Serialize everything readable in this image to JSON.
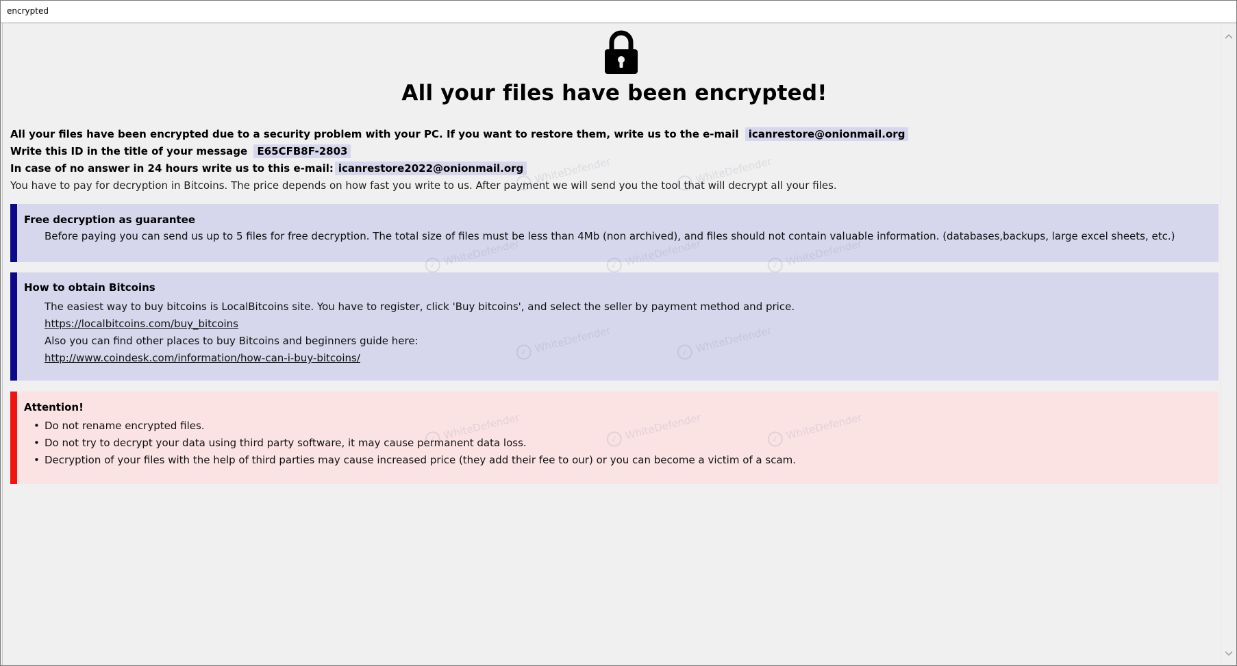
{
  "window": {
    "title": "encrypted"
  },
  "header": {
    "headline": "All your files have been encrypted!"
  },
  "intro": {
    "line1_text": "All your files have been encrypted due to a security problem with your PC. If you want to restore them, write us to the e-mail",
    "line1_email": "icanrestore@onionmail.org",
    "line2_text": "Write this ID in the title of your message",
    "line2_id": "E65CFB8F-2803",
    "line3_text": "In case of no answer in 24 hours write us to this e-mail:",
    "line3_email": "icanrestore2022@onionmail.org",
    "line4_text": "You have to pay for decryption in Bitcoins. The price depends on how fast you write to us. After payment we will send you the tool that will decrypt all your files."
  },
  "panels": {
    "free": {
      "title": "Free decryption as guarantee",
      "text": "Before paying you can send us up to 5 files for free decryption. The total size of files must be less than 4Mb (non archived), and files should not contain valuable information. (databases,backups, large excel sheets, etc.)"
    },
    "bitcoins": {
      "title": "How to obtain Bitcoins",
      "text1": "The easiest way to buy bitcoins is LocalBitcoins site. You have to register, click 'Buy bitcoins', and select the seller by payment method and price.",
      "link1": "https://localbitcoins.com/buy_bitcoins",
      "text2": "Also you can find other places to buy Bitcoins and beginners guide here:",
      "link2": "http://www.coindesk.com/information/how-can-i-buy-bitcoins/"
    },
    "attention": {
      "title": "Attention!",
      "items": [
        "Do not rename encrypted files.",
        "Do not try to decrypt your data using third party software, it may cause permanent data loss.",
        "Decryption of your files with the help of third parties may cause increased price (they add their fee to our) or you can become a victim of a scam."
      ]
    }
  },
  "watermark": {
    "text": "WhiteDefender"
  },
  "icons": {
    "lock": "lock-icon",
    "scroll_up": "chevron-up-icon",
    "scroll_down": "chevron-down-icon",
    "watermark_check": "check-circle-icon"
  },
  "colors": {
    "panel_blue_bg": "#d6d6ec",
    "panel_blue_bar": "#0a0a8a",
    "panel_red_bg": "#fbe3e3",
    "panel_red_bar": "#f11212",
    "link": "#1a5fc8",
    "window_bg": "#f0f0f0"
  }
}
